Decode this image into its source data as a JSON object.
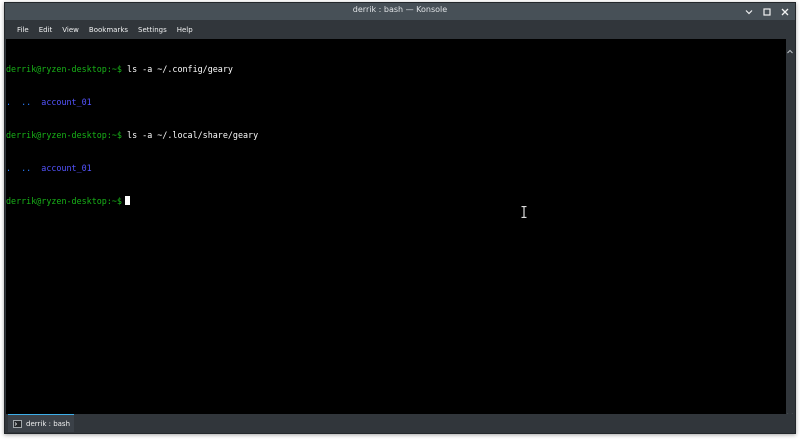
{
  "window": {
    "title": "derrik : bash — Konsole"
  },
  "menubar": {
    "items": [
      "File",
      "Edit",
      "View",
      "Bookmarks",
      "Settings",
      "Help"
    ]
  },
  "terminal": {
    "lines": [
      {
        "prompt": "derrik@ryzen-desktop:~$",
        "command": " ls -a ~/.config/geary"
      },
      {
        "dots": ".  ..",
        "entry": "  account_01"
      },
      {
        "prompt": "derrik@ryzen-desktop:~$",
        "command": " ls -a ~/.local/share/geary"
      },
      {
        "dots": ".  ..",
        "entry": "  account_01"
      },
      {
        "prompt": "derrik@ryzen-desktop:~$",
        "command": ""
      }
    ]
  },
  "tabs": [
    {
      "label": "derrik : bash",
      "icon": "terminal-icon"
    }
  ],
  "colors": {
    "prompt": "#18b218",
    "directory": "#5454ff",
    "accent": "#3daee9"
  }
}
